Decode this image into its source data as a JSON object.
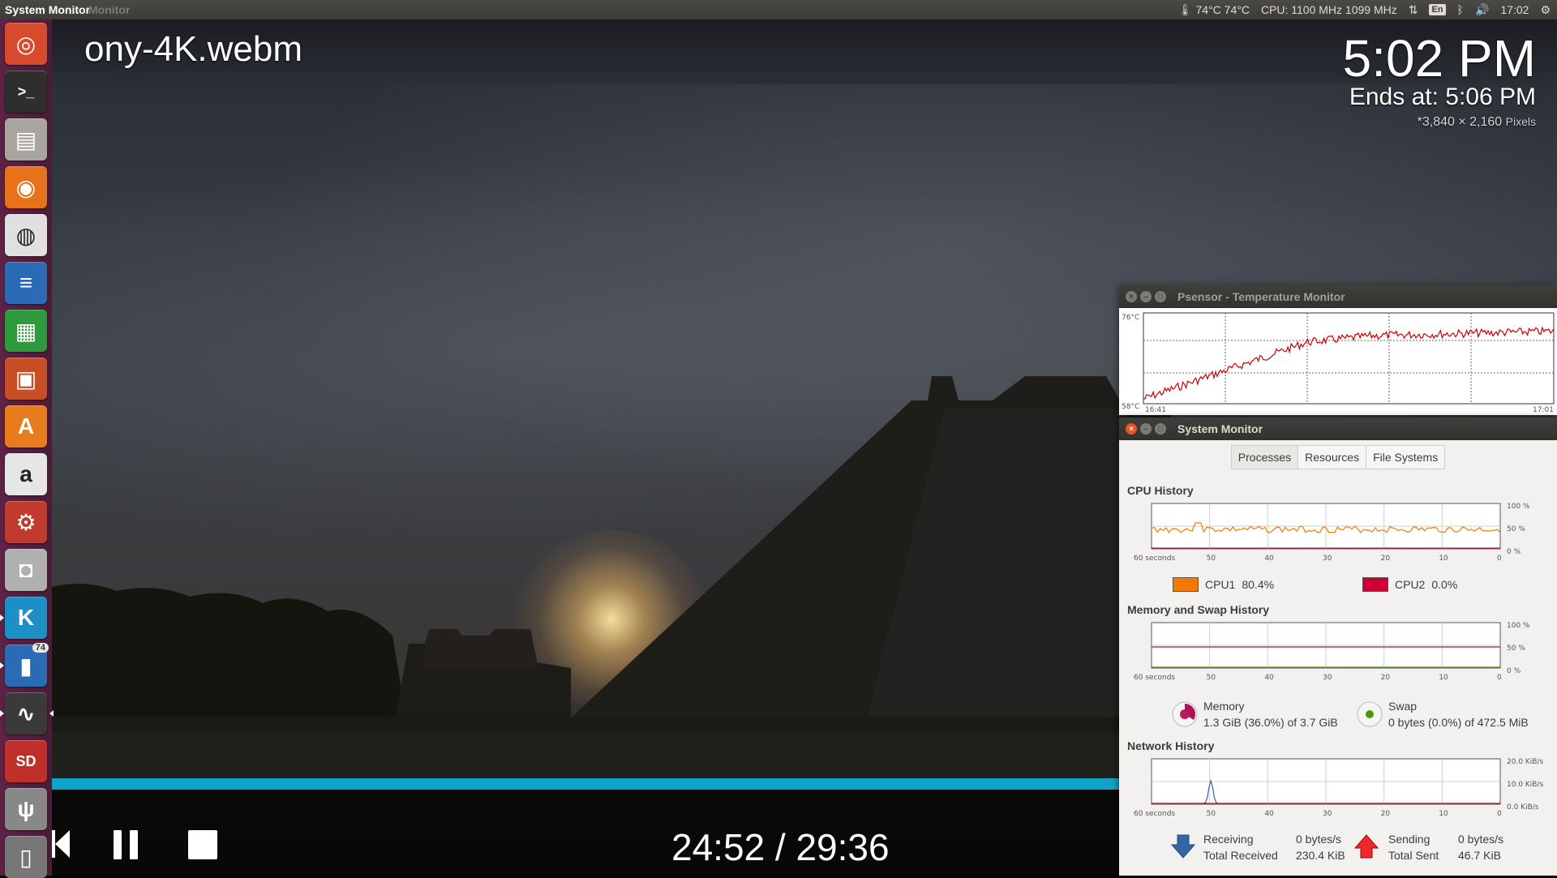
{
  "top_panel": {
    "app_title": "System Monitor",
    "app_title_ghost": "Monitor",
    "temperature": "74°C 74°C",
    "cpu_freq": "CPU: 1100 MHz 1099 MHz",
    "keyboard": "En",
    "clock": "17:02"
  },
  "launcher": {
    "items": [
      {
        "name": "ubuntu-dash",
        "color": "#d84a2d"
      },
      {
        "name": "terminal",
        "color": "#2e2e2e"
      },
      {
        "name": "files",
        "color": "#a8a59e"
      },
      {
        "name": "firefox",
        "color": "#e8711c"
      },
      {
        "name": "chrome",
        "color": "#e0e0e0"
      },
      {
        "name": "writer",
        "color": "#2b6ab4"
      },
      {
        "name": "calc",
        "color": "#2e9a3d"
      },
      {
        "name": "impress",
        "color": "#c84f25"
      },
      {
        "name": "software-center",
        "color": "#e87b1c"
      },
      {
        "name": "amazon",
        "color": "#e6e6e6"
      },
      {
        "name": "system-settings",
        "color": "#c03b2b"
      },
      {
        "name": "cheese",
        "color": "#b0b0b0"
      },
      {
        "name": "kodi",
        "color": "#1b8fc6"
      },
      {
        "name": "psensor",
        "color": "#2b6ab4"
      },
      {
        "name": "system-monitor",
        "color": "#3a3a3a"
      },
      {
        "name": "sd-card",
        "color": "#c0302a"
      },
      {
        "name": "usb",
        "color": "#888888"
      },
      {
        "name": "trash",
        "color": "#777777"
      }
    ],
    "psensor_badge": "74"
  },
  "video": {
    "filename": "ony-4K.webm",
    "clock": "5:02 PM",
    "ends_at": "Ends at: 5:06 PM",
    "resolution": "*3,840 × 2,160",
    "resolution_unit": "Pixels",
    "time": "24:52 / 29:36",
    "progress": 0.84
  },
  "psensor": {
    "title": "Psensor - Temperature Monitor",
    "y_max": "76°C",
    "y_min": "58°C",
    "x_start": "16:41",
    "x_end": "17:01"
  },
  "sysmon": {
    "title": "System Monitor",
    "tabs": [
      "Processes",
      "Resources",
      "File Systems"
    ],
    "cpu": {
      "title": "CPU History",
      "cpu1_label": "CPU1",
      "cpu1_value": "80.4%",
      "cpu1_color": "#f57900",
      "cpu2_label": "CPU2",
      "cpu2_value": "0.0%",
      "cpu2_color": "#cc0033"
    },
    "memory": {
      "title": "Memory and Swap History",
      "memory_label": "Memory",
      "memory_value": "1.3 GiB (36.0%) of 3.7 GiB",
      "swap_label": "Swap",
      "swap_value": "0 bytes (0.0%) of 472.5 MiB"
    },
    "network": {
      "title": "Network History",
      "receiving_label": "Receiving",
      "receiving_value": "0 bytes/s",
      "total_received_label": "Total Received",
      "total_received_value": "230.4 KiB",
      "sending_label": "Sending",
      "sending_value": "0 bytes/s",
      "total_sent_label": "Total Sent",
      "total_sent_value": "46.7 KiB"
    },
    "axis": {
      "x_labels": [
        "60 seconds",
        "50",
        "40",
        "30",
        "20",
        "10",
        "0"
      ],
      "pct_labels": [
        "100 %",
        "50 %",
        "0 %"
      ],
      "net_labels": [
        "20.0 KiB/s",
        "10.0 KiB/s",
        "0.0 KiB/s"
      ]
    }
  }
}
